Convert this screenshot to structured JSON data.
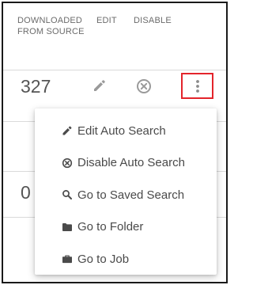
{
  "table": {
    "headers": {
      "downloaded": "DOWNLOADED FROM SOURCE",
      "edit": "EDIT",
      "disable": "DISABLE"
    },
    "rows": [
      {
        "downloaded": "327"
      },
      {
        "downloaded": "0"
      }
    ]
  },
  "icons": {
    "edit": "pencil-icon",
    "disable": "circle-x-icon",
    "more": "vertical-dots-icon"
  },
  "highlight_color": "#e3242b",
  "menu": {
    "items": [
      {
        "label": "Edit Auto Search",
        "icon": "pencil-icon"
      },
      {
        "label": "Disable Auto Search",
        "icon": "circle-x-icon"
      },
      {
        "label": "Go to Saved Search",
        "icon": "search-icon"
      },
      {
        "label": "Go to Folder",
        "icon": "folder-icon"
      },
      {
        "label": "Go to Job",
        "icon": "briefcase-icon"
      }
    ]
  }
}
